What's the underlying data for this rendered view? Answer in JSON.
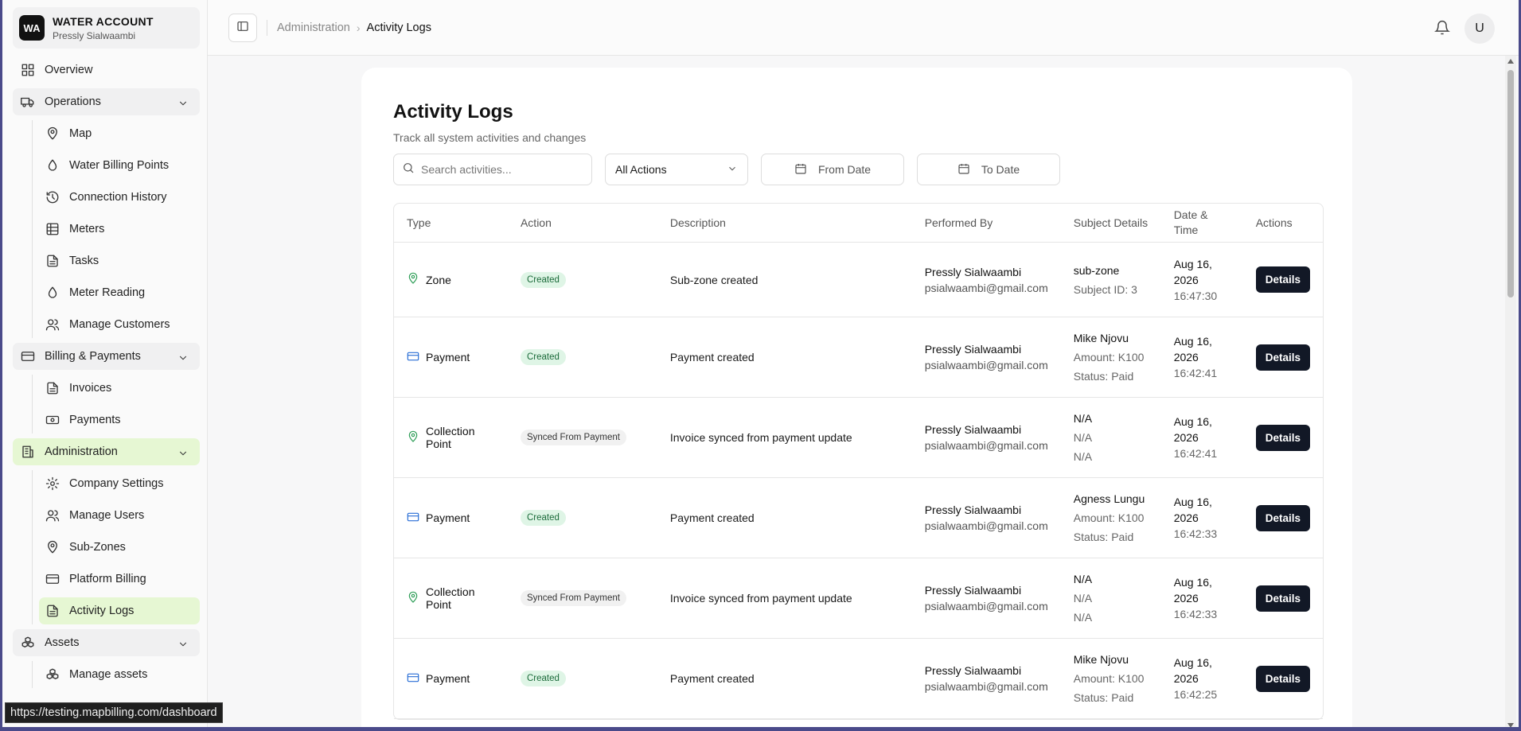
{
  "account": {
    "logo": "WA",
    "name": "WATER ACCOUNT",
    "user": "Pressly Sialwaambi"
  },
  "sidebar": {
    "overview": "Overview",
    "operations": {
      "label": "Operations",
      "items": [
        "Map",
        "Water Billing Points",
        "Connection History",
        "Meters",
        "Tasks",
        "Meter Reading",
        "Manage Customers"
      ]
    },
    "billing": {
      "label": "Billing & Payments",
      "items": [
        "Invoices",
        "Payments"
      ]
    },
    "administration": {
      "label": "Administration",
      "items": [
        "Company Settings",
        "Manage Users",
        "Sub-Zones",
        "Platform Billing",
        "Activity Logs"
      ]
    },
    "assets": {
      "label": "Assets",
      "items": [
        "Manage assets"
      ]
    }
  },
  "header": {
    "breadcrumb_parent": "Administration",
    "breadcrumb_current": "Activity Logs",
    "avatar": "U"
  },
  "page": {
    "title": "Activity Logs",
    "subtitle": "Track all system activities and changes",
    "search_placeholder": "Search activities...",
    "action_filter": "All Actions",
    "from_date": "From Date",
    "to_date": "To Date"
  },
  "table": {
    "headers": [
      "Type",
      "Action",
      "Description",
      "Performed By",
      "Subject Details",
      "Date & Time",
      "Actions"
    ],
    "rows": [
      {
        "type": "Zone",
        "action": "Created",
        "description": "Sub-zone created",
        "performer": "Pressly Sialwaambi",
        "email": "psialwaambi@gmail.com",
        "subject": [
          "sub-zone",
          "Subject ID: 3"
        ],
        "date": "Aug 16, 2026",
        "time": "16:47:30",
        "button": "Details"
      },
      {
        "type": "Payment",
        "action": "Created",
        "description": "Payment created",
        "performer": "Pressly Sialwaambi",
        "email": "psialwaambi@gmail.com",
        "subject": [
          "Mike Njovu",
          "Amount: K100",
          "Status: Paid"
        ],
        "date": "Aug 16, 2026",
        "time": "16:42:41",
        "button": "Details"
      },
      {
        "type": "Collection Point",
        "action": "Synced From Payment",
        "description": "Invoice synced from payment update",
        "performer": "Pressly Sialwaambi",
        "email": "psialwaambi@gmail.com",
        "subject": [
          "N/A",
          "N/A",
          "N/A"
        ],
        "date": "Aug 16, 2026",
        "time": "16:42:41",
        "button": "Details"
      },
      {
        "type": "Payment",
        "action": "Created",
        "description": "Payment created",
        "performer": "Pressly Sialwaambi",
        "email": "psialwaambi@gmail.com",
        "subject": [
          "Agness Lungu",
          "Amount: K100",
          "Status: Paid"
        ],
        "date": "Aug 16, 2026",
        "time": "16:42:33",
        "button": "Details"
      },
      {
        "type": "Collection Point",
        "action": "Synced From Payment",
        "description": "Invoice synced from payment update",
        "performer": "Pressly Sialwaambi",
        "email": "psialwaambi@gmail.com",
        "subject": [
          "N/A",
          "N/A",
          "N/A"
        ],
        "date": "Aug 16, 2026",
        "time": "16:42:33",
        "button": "Details"
      },
      {
        "type": "Payment",
        "action": "Created",
        "description": "Payment created",
        "performer": "Pressly Sialwaambi",
        "email": "psialwaambi@gmail.com",
        "subject": [
          "Mike Njovu",
          "Amount: K100",
          "Status: Paid"
        ],
        "date": "Aug 16, 2026",
        "time": "16:42:25",
        "button": "Details"
      }
    ]
  },
  "status_url": "https://testing.mapbilling.com/dashboard",
  "colors": {
    "active_bg": "#e6f7d3",
    "zone_icon": "#2e9e57",
    "payment_icon": "#2a6fd6",
    "button_bg": "#121826"
  }
}
